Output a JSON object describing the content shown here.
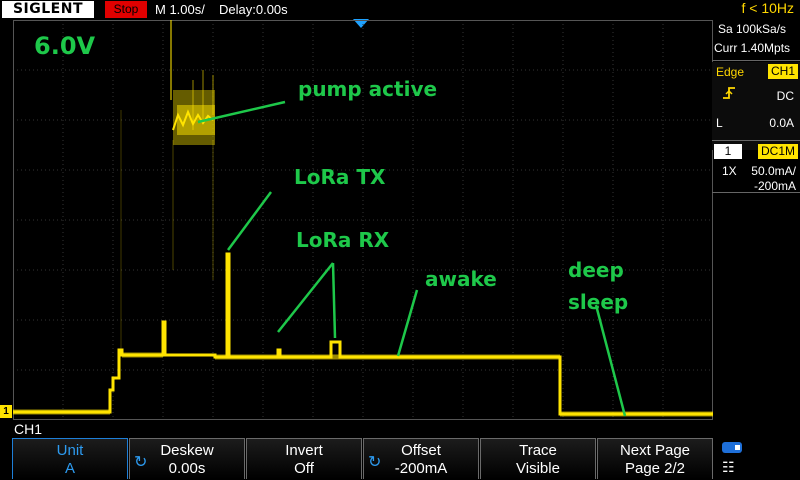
{
  "top_bar": {
    "brand": "SIGLENT",
    "run_state": "Stop",
    "timebase": "M 1.00s/",
    "delay": "Delay:0.00s",
    "trigger_frequency": "f < 10Hz"
  },
  "acquisition": {
    "sample_rate": "Sa 100kSa/s",
    "memory_depth": "Curr 1.40Mpts"
  },
  "trigger": {
    "type": "Edge",
    "source": "CH1",
    "slope_icon": "rising-edge-icon",
    "coupling": "DC",
    "level_label": "L",
    "level": "0.0A"
  },
  "channel": {
    "number": "1",
    "coupling": "DC1M",
    "probe": "1X",
    "scale": "50.0mA/",
    "offset": "-200mA",
    "label": "CH1",
    "ground_marker": "1",
    "color": "#ffe400"
  },
  "annotations": {
    "voltage": "6.0V",
    "pump_active": "pump active",
    "lora_tx": "LoRa TX",
    "lora_rx": "LoRa RX",
    "awake": "awake",
    "deep": "deep",
    "sleep": "sleep",
    "color": "#1ec84a"
  },
  "menu": {
    "unit": {
      "title": "Unit",
      "value": "A"
    },
    "deskew": {
      "title": "Deskew",
      "value": "0.00s"
    },
    "invert": {
      "title": "Invert",
      "value": "Off"
    },
    "offset": {
      "title": "Offset",
      "value": "-200mA"
    },
    "trace": {
      "title": "Trace",
      "value": "Visible"
    },
    "next_page": {
      "title": "Next Page",
      "value": "Page 2/2"
    }
  },
  "status_icons": [
    "usb-icon",
    "network-icon"
  ]
}
